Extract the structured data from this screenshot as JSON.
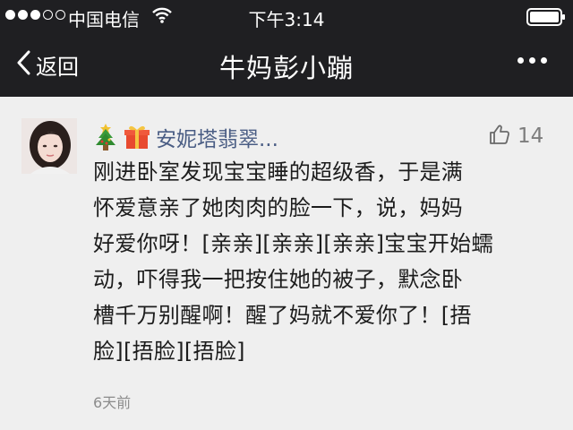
{
  "status_bar": {
    "carrier": "中国电信",
    "time": "下午3:14",
    "signal_bars_filled": 3,
    "signal_bars_total": 5
  },
  "nav": {
    "back_label": "返回",
    "title": "牛妈彭小蹦"
  },
  "comment": {
    "author": "安妮塔翡翠...",
    "likes": "14",
    "text_lines": [
      "刚进卧室发现宝宝睡的超级香，于是满",
      "怀爱意亲了她肉肉的脸一下，说，妈妈",
      "好爱你呀！[亲亲][亲亲][亲亲]宝宝开始蠕",
      "动，吓得我一把按住她的被子，默念卧",
      "槽千万别醒啊！醒了妈就不爱你了！[捂",
      "脸][捂脸][捂脸]"
    ],
    "time_ago": "6天前"
  },
  "icons": {
    "signal": "signal-dots-icon",
    "wifi": "wifi-icon",
    "battery": "battery-icon",
    "back": "chevron-left-icon",
    "more": "more-dots-icon",
    "tree": "christmas-tree-icon",
    "gift": "gift-icon",
    "like": "thumbs-up-icon"
  },
  "colors": {
    "header_bg": "#1f1f22",
    "content_bg": "#efefef",
    "author_name": "#4a5d84",
    "meta_text": "#8c8c8c"
  }
}
